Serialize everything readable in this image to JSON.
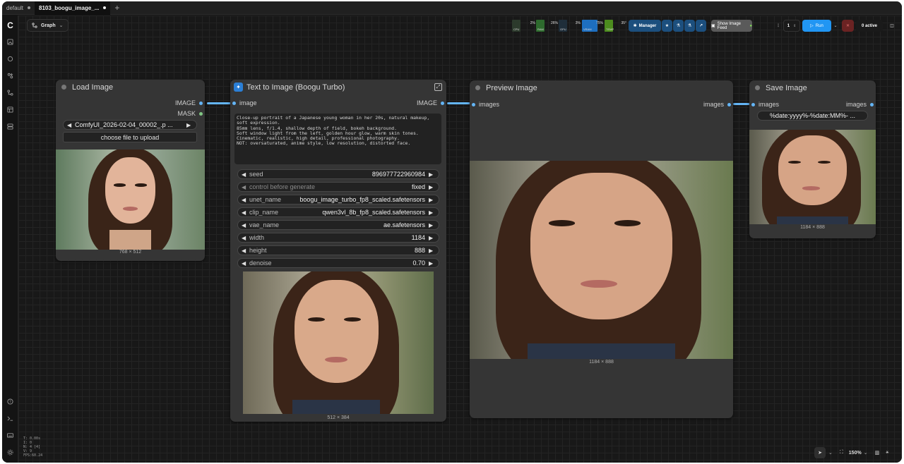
{
  "tabs": [
    {
      "label": "default"
    },
    {
      "label": "8103_boogu_image_..."
    }
  ],
  "graph_button": {
    "label": "Graph"
  },
  "monitor": {
    "cpu": {
      "label": "CPU",
      "value": "2%"
    },
    "ram": {
      "label": "RAM",
      "value": "26%"
    },
    "gpu": {
      "label": "GPU",
      "value": "3%"
    },
    "vram": {
      "label": "VRAM",
      "value": "75%"
    },
    "temp": {
      "label": "TEMP",
      "value": "35°"
    }
  },
  "toolbar": {
    "manager_label": "Manager",
    "image_feed_label": "Show Image Feed",
    "queue_count": "1",
    "run_label": "Run",
    "active_label": "0 active"
  },
  "colors": {
    "accent": "#64b5f6",
    "run": "#2196f3",
    "link": "#64b5f6"
  },
  "nodes": {
    "load_image": {
      "title": "Load Image",
      "out_image": "IMAGE",
      "out_mask": "MASK",
      "file_value": "ComfyUI_2026-02-04_00002_.p ...",
      "upload_label": "choose file to upload",
      "caption": "768 × 512"
    },
    "text_to_image": {
      "title": "Text to Image (Boogu Turbo)",
      "in_image": "image",
      "out_image": "IMAGE",
      "prompt": "Close-up portrait of a Japanese young woman in her 20s, natural makeup, soft expression.\n85mm lens, f/1.4, shallow depth of field, bokeh background.\nSoft window light from the left, golden hour glow, warm skin tones.\nCinematic, realistic, high detail, professional photography.\nNOT: oversaturated, anime style, low resolution, distorted face.",
      "widgets": [
        {
          "name": "seed",
          "value": "896977722960984"
        },
        {
          "name": "control before generate",
          "value": "fixed"
        },
        {
          "name": "unet_name",
          "value": "boogu_image_turbo_fp8_scaled.safetensors"
        },
        {
          "name": "clip_name",
          "value": "qwen3vl_8b_fp8_scaled.safetensors"
        },
        {
          "name": "vae_name",
          "value": "ae.safetensors"
        },
        {
          "name": "width",
          "value": "1184"
        },
        {
          "name": "height",
          "value": "888"
        },
        {
          "name": "denoise",
          "value": "0.70"
        }
      ],
      "caption": "512 × 384"
    },
    "preview_image": {
      "title": "Preview Image",
      "in_images": "images",
      "out_images": "images",
      "caption": "1184 × 888"
    },
    "save_image": {
      "title": "Save Image",
      "in_images": "images",
      "out_images": "images",
      "filename_prefix": "%date:yyyy%-%date:MM%- ...",
      "caption": "1184 × 888"
    }
  },
  "debug_info": [
    "T: 0.00s",
    "I: 0",
    "N: 4 [4]",
    "V: 9",
    "FPS:60.24"
  ],
  "zoom": "150%"
}
